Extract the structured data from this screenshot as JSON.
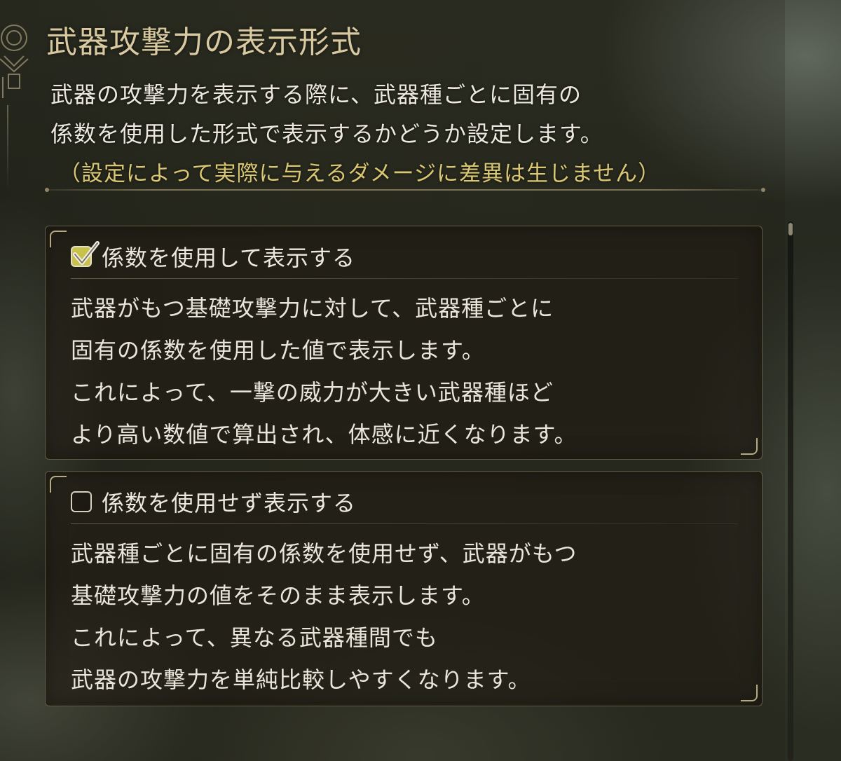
{
  "header": {
    "title": "武器攻撃力の表示形式",
    "description_lines": [
      "武器の攻撃力を表示する際に、武器種ごとに固有の",
      "係数を使用した形式で表示するかどうか設定します。"
    ],
    "note": "（設定によって実際に与えるダメージに差異は生じません）"
  },
  "options": [
    {
      "label": "係数を使用して表示する",
      "checked": true,
      "lines": [
        "武器がもつ基礎攻撃力に対して、武器種ごとに",
        "固有の係数を使用した値で表示します。",
        "これによって、一撃の威力が大きい武器種ほど",
        "より高い数値で算出され、体感に近くなります。"
      ]
    },
    {
      "label": "係数を使用せず表示する",
      "checked": false,
      "lines": [
        "武器種ごとに固有の係数を使用せず、武器がもつ",
        "基礎攻撃力の値をそのまま表示します。",
        "これによって、異なる武器種間でも",
        "武器の攻撃力を単純比較しやすくなります。"
      ]
    }
  ],
  "colors": {
    "title": "#d8c9a0",
    "text": "#ece8de",
    "note": "#d9c774",
    "checkbox_checked": "#c8c24a",
    "frame": "#b7a981"
  },
  "icons": {
    "corner": "ornament-emblem-icon",
    "check": "checkmark-icon"
  }
}
